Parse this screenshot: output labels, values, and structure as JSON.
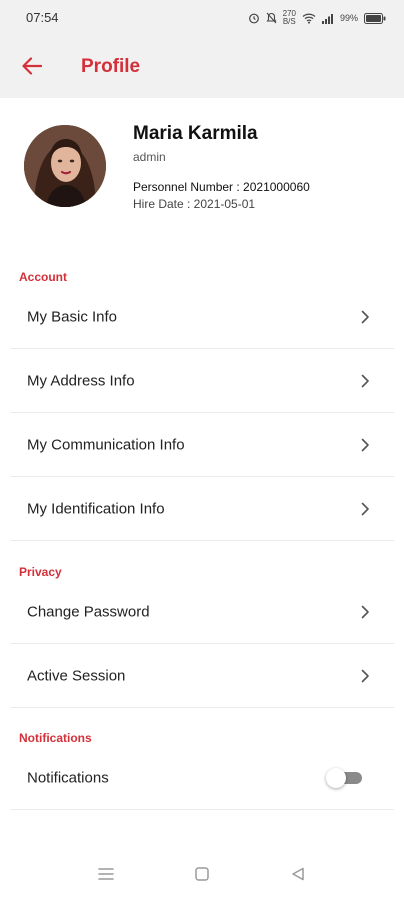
{
  "status_bar": {
    "time": "07:54",
    "network_speed_top": "270",
    "network_speed_bottom": "B/S",
    "battery": "99%"
  },
  "app_bar": {
    "title": "Profile",
    "back_icon": "arrow-left-icon"
  },
  "profile": {
    "name": "Maria Karmila",
    "role": "admin",
    "personnel_number": "Personnel Number : 2021000060",
    "hire_date": "Hire Date : 2021-05-01"
  },
  "sections": {
    "account": {
      "label": "Account",
      "items": [
        {
          "label": "My Basic Info"
        },
        {
          "label": "My Address Info"
        },
        {
          "label": "My Communication Info"
        },
        {
          "label": "My Identification Info"
        }
      ]
    },
    "privacy": {
      "label": "Privacy",
      "items": [
        {
          "label": "Change Password"
        },
        {
          "label": "Active Session"
        }
      ]
    },
    "notifications": {
      "label": "Notifications",
      "items": [
        {
          "label": "Notifications",
          "enabled": false
        }
      ]
    }
  },
  "colors": {
    "accent": "#d4303a",
    "header_bg": "#f1f1f1"
  }
}
